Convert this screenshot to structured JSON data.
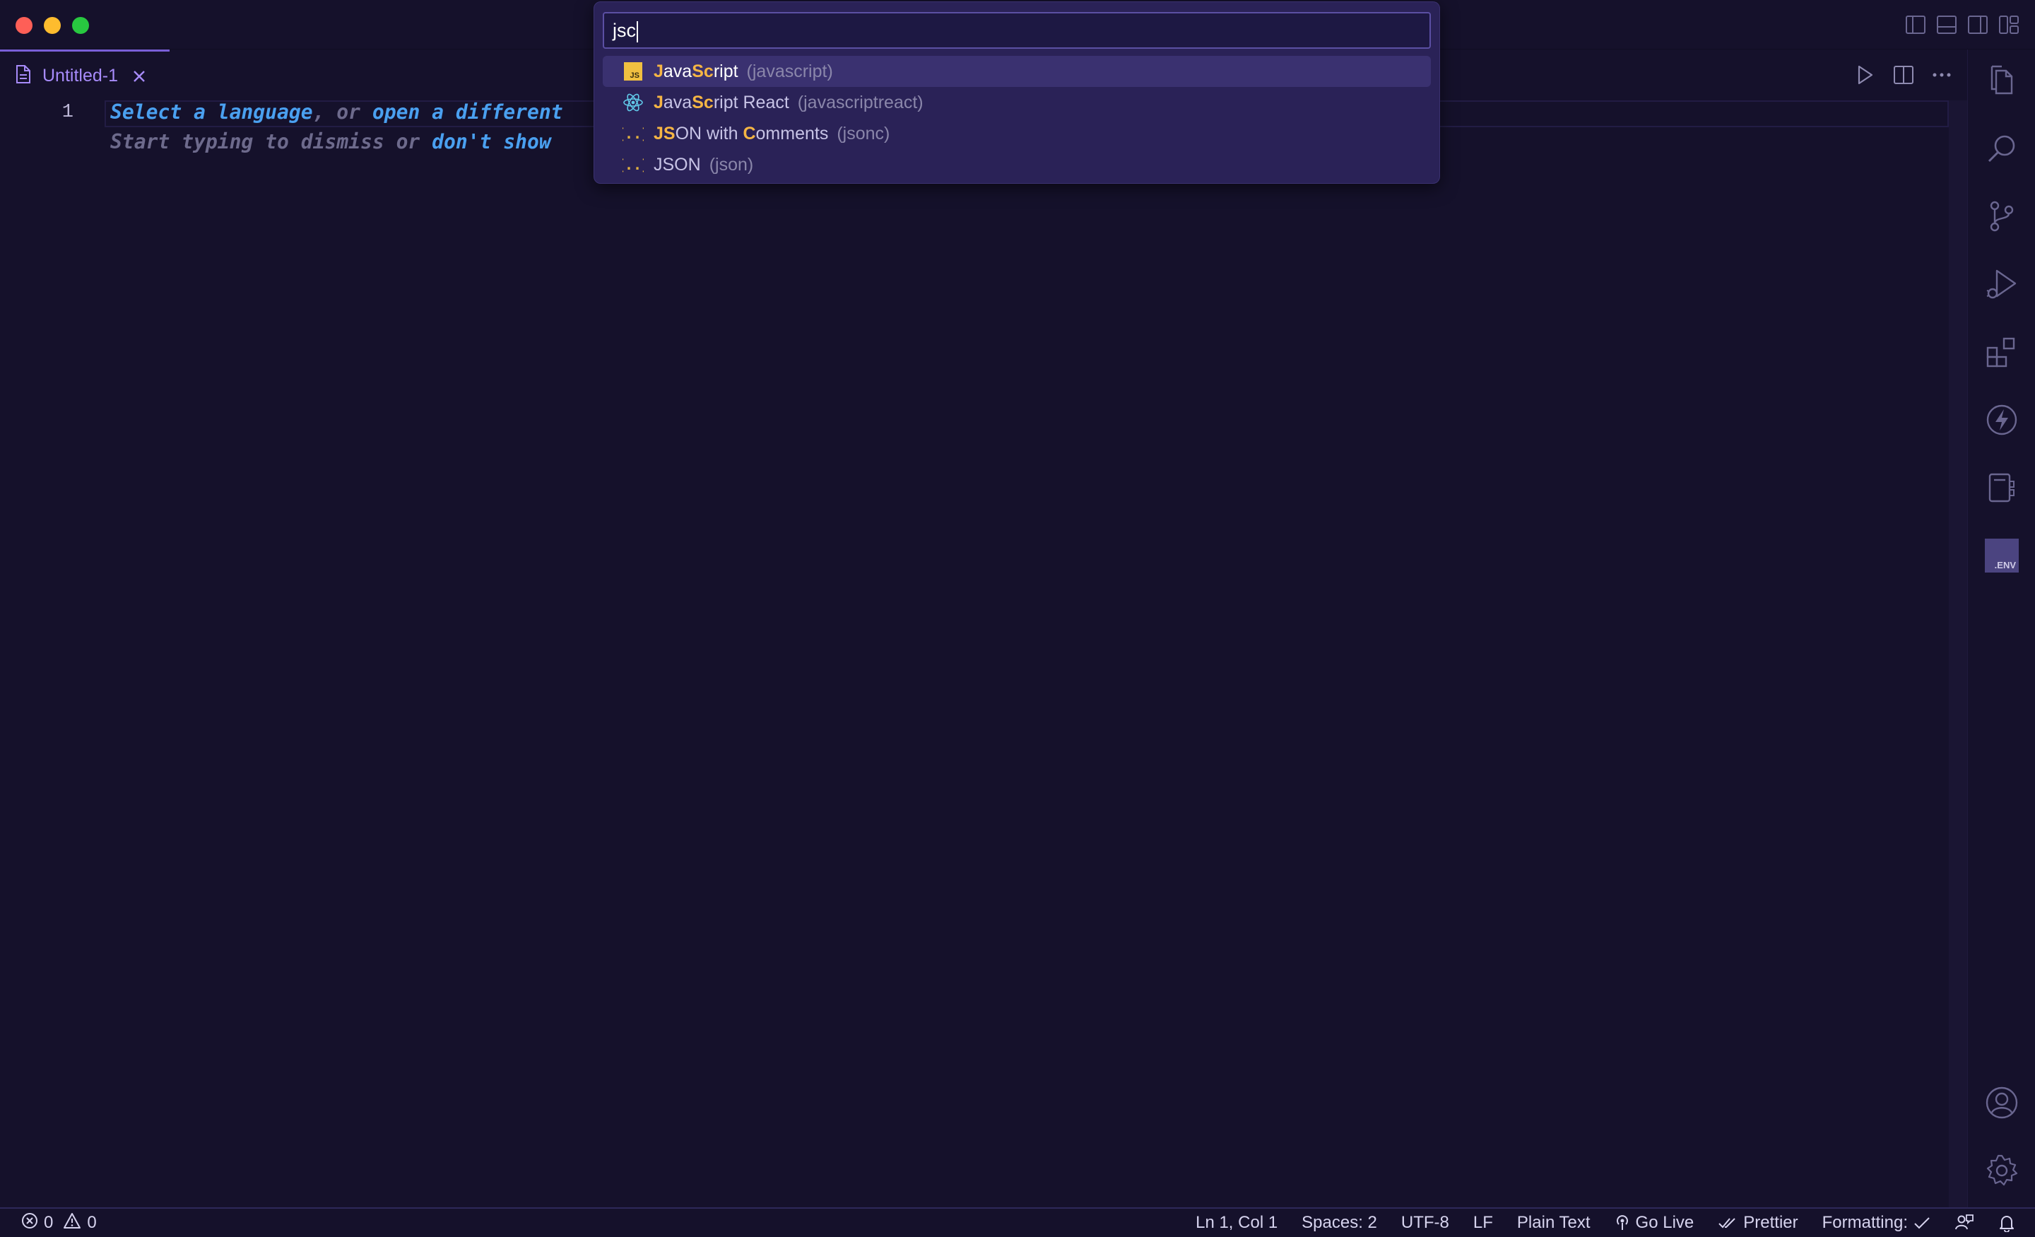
{
  "window": {
    "accent": "#7a5fd8",
    "background": "#15112b"
  },
  "tab": {
    "label": "Untitled-1",
    "icon": "file-icon"
  },
  "editor": {
    "line_number": "1",
    "hint_line1": {
      "part1": "Select a language",
      "part2": ", or ",
      "part3": "open a different"
    },
    "hint_line2": {
      "part1": "Start typing to dismiss or ",
      "part2": "don't show"
    }
  },
  "palette": {
    "query": "jsc",
    "items": [
      {
        "pre": "",
        "m1": "J",
        "mid": "ava",
        "m2": "Sc",
        "post": "ript",
        "id": "(javascript)",
        "icon": "javascript-file-icon"
      },
      {
        "pre": "",
        "m1": "J",
        "mid": "ava",
        "m2": "Sc",
        "post": "ript React",
        "id": "(javascriptreact)",
        "icon": "react-icon"
      },
      {
        "pre": "",
        "m1": "JS",
        "mid": "ON with ",
        "m2": "C",
        "post": "omments",
        "id": "(jsonc)",
        "icon": "json-braces-icon"
      },
      {
        "pre": "",
        "m1": "",
        "mid": "JSON",
        "m2": "",
        "post": "",
        "id": "(json)",
        "icon": "json-braces-icon"
      }
    ]
  },
  "statusbar": {
    "errors": "0",
    "warnings": "0",
    "position": "Ln 1, Col 1",
    "spaces": "Spaces: 2",
    "encoding": "UTF-8",
    "eol": "LF",
    "language": "Plain Text",
    "go_live": "Go Live",
    "prettier": "Prettier",
    "formatting": "Formatting:"
  },
  "activity_bar": [
    "explorer-icon",
    "search-icon",
    "source-control-icon",
    "run-debug-icon",
    "extensions-icon",
    "thunder-icon",
    "notebook-icon",
    "env-icon",
    "account-icon",
    "settings-gear-icon"
  ]
}
